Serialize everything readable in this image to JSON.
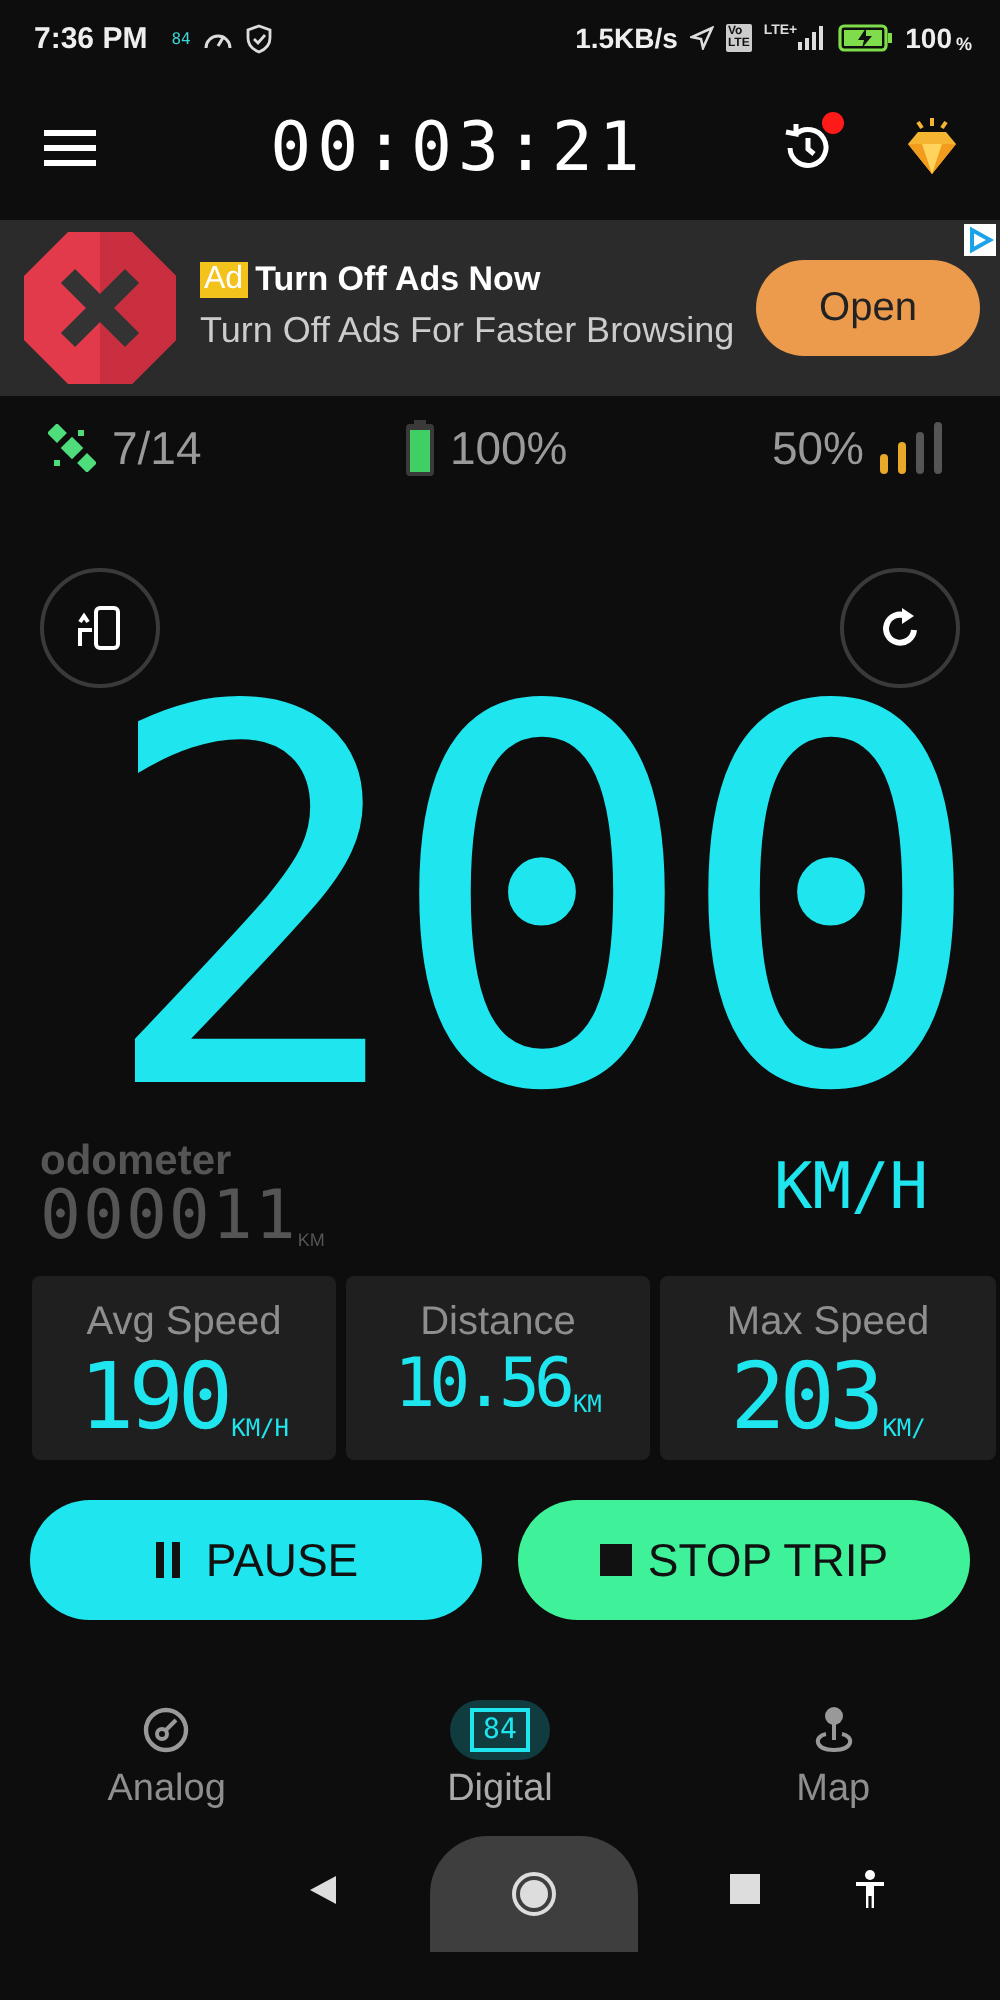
{
  "status_bar": {
    "time": "7:36 PM",
    "app_badge": "84",
    "net_speed": "1.5KB/s",
    "volte_top": "Vo",
    "volte_bottom": "LTE",
    "network": "LTE+",
    "battery": "100",
    "battery_unit": "%"
  },
  "toolbar": {
    "timer": "00:03:21",
    "history_notification": true
  },
  "ad": {
    "badge": "Ad",
    "title": "Turn Off Ads Now",
    "body": "Turn Off Ads For Faster Browsing",
    "button": "Open"
  },
  "info_row": {
    "satellites": "7/14",
    "battery": "100%",
    "signal": "50%"
  },
  "speed": {
    "value": "200",
    "unit": "KM/H"
  },
  "odometer": {
    "label": "odometer",
    "value": "000011",
    "unit": "KM"
  },
  "stats": [
    {
      "label": "Avg Speed",
      "value": "190",
      "unit": "KM/H"
    },
    {
      "label": "Distance",
      "value": "10.56",
      "unit": "KM"
    },
    {
      "label": "Max Speed",
      "value": "203",
      "unit": "KM/"
    }
  ],
  "buttons": [
    {
      "kind": "pause",
      "label": "PAUSE"
    },
    {
      "kind": "stop",
      "label": "STOP TRIP"
    }
  ],
  "tabs": [
    {
      "kind": "analog",
      "label": "Analog",
      "selected": false
    },
    {
      "kind": "digital",
      "label": "Digital",
      "icon_text": "84",
      "selected": true
    },
    {
      "kind": "map",
      "label": "Map",
      "selected": false
    }
  ]
}
